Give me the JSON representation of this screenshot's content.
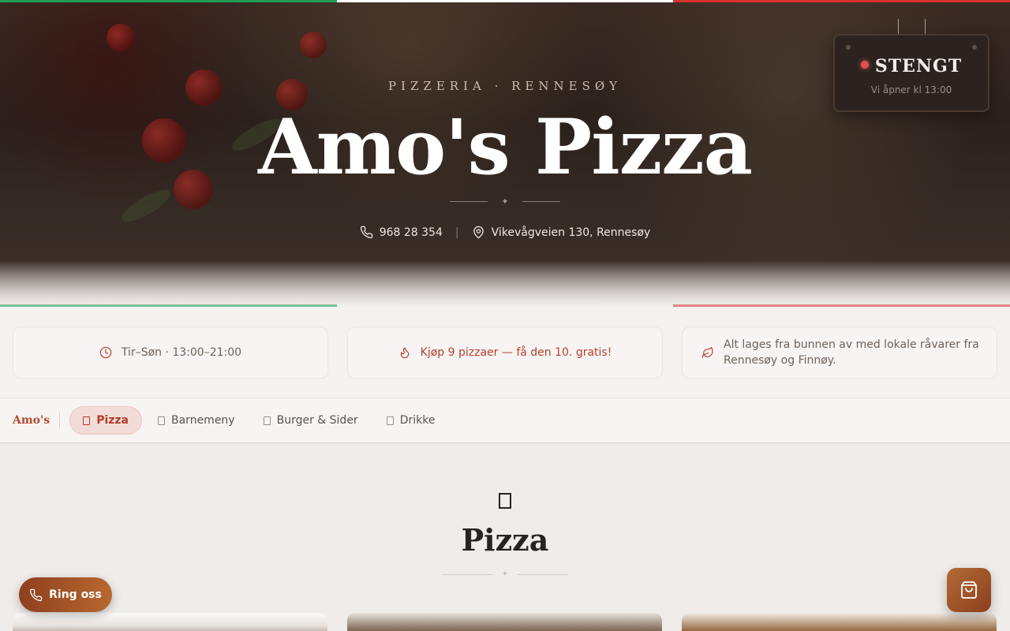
{
  "colors": {
    "flag_green": "#1f9d55",
    "flag_white": "#ffffff",
    "flag_red": "#d8312f",
    "accent": "#b13c2a",
    "brand": "#b04a2a"
  },
  "hero": {
    "eyebrow": "PIZZERIA · RENNESØY",
    "title": "Amo's Pizza",
    "phone": "968 28 354",
    "separator": "|",
    "address": "Vikevågveien 130, Rennesøy",
    "divider_glyph": "✦"
  },
  "status_sign": {
    "status": "STENGT",
    "opens": "Vi åpner kl 13:00"
  },
  "info_cards": {
    "hours": "Tir–Søn · 13:00–21:00",
    "promo": "Kjøp 9 pizzaer — få den 10. gratis!",
    "local": "Alt lages fra bunnen av med lokale råvarer fra Rennesøy og Finnøy."
  },
  "nav": {
    "brand": "Amo's",
    "tabs": [
      {
        "label": "Pizza",
        "active": true
      },
      {
        "label": "Barnemeny",
        "active": false
      },
      {
        "label": "Burger & Sider",
        "active": false
      },
      {
        "label": "Drikke",
        "active": false
      }
    ]
  },
  "section": {
    "title": "Pizza",
    "divider_glyph": "✦"
  },
  "floating": {
    "call_label": "Ring oss",
    "call_icon": "phone-icon",
    "cart_icon": "shopping-bag-icon"
  }
}
